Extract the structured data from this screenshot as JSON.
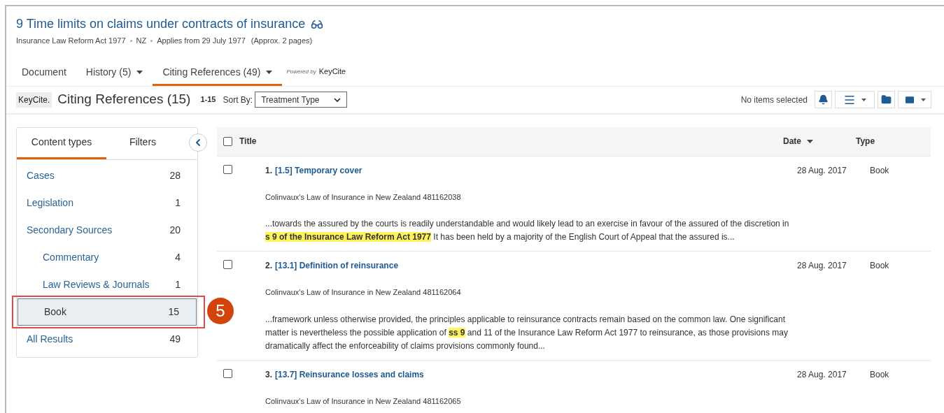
{
  "document": {
    "title": "9 Time limits on claims under contracts of insurance",
    "meta": [
      "Insurance Law Reform Act 1977",
      "NZ",
      "Applies from 29 July 1977"
    ],
    "pages": "(Approx. 2 pages)"
  },
  "tabs": [
    {
      "label": "Document",
      "selected": false,
      "dropdown": false
    },
    {
      "label": "History (5)",
      "selected": false,
      "dropdown": true
    },
    {
      "label": "Citing References (49)",
      "selected": true,
      "dropdown": true
    }
  ],
  "powered_by": {
    "label": "Powered by",
    "brand": "KeyCite"
  },
  "toolbar": {
    "logo": "KeyCite.",
    "heading": "Citing References (15)",
    "range": "1-15",
    "sort_label": "Sort By:",
    "sort_value": "Treatment Type",
    "selection_status": "No items selected"
  },
  "sidebar": {
    "tabs": [
      {
        "label": "Content types",
        "selected": true
      },
      {
        "label": "Filters",
        "selected": false
      }
    ],
    "items": [
      {
        "label": "Cases",
        "count": "28",
        "selected": false
      },
      {
        "label": "Legislation",
        "count": "1",
        "selected": false
      },
      {
        "label": "Secondary Sources",
        "count": "20",
        "selected": false,
        "children": [
          {
            "label": "Commentary",
            "count": "4",
            "selected": false
          },
          {
            "label": "Law Reviews & Journals",
            "count": "1",
            "selected": false
          },
          {
            "label": "Book",
            "count": "15",
            "selected": true
          }
        ]
      },
      {
        "label": "All Results",
        "count": "49",
        "selected": false
      }
    ]
  },
  "callout": {
    "number": "5"
  },
  "table": {
    "select_all_checked": false,
    "columns": [
      "Title",
      "Date",
      "Type"
    ],
    "rows": [
      {
        "number": "1.",
        "title": "[1.5] Temporary cover",
        "date": "28 Aug. 2017",
        "type": "Book",
        "checked": false,
        "source": "Colinvaux's Law of Insurance in New Zealand 481162038",
        "snippet_before": "...towards the assured by the courts is readily understandable and would likely lead to an exercise in favour of the assured of the discretion in ",
        "snippet_highlight": "s 9 of the Insurance Law Reform Act 1977",
        "snippet_after": " It has been held by a majority of the English Court of Appeal that the assured is..."
      },
      {
        "number": "2.",
        "title": "[13.1] Definition of reinsurance",
        "date": "28 Aug. 2017",
        "type": "Book",
        "checked": false,
        "source": "Colinvaux's Law of Insurance in New Zealand 481162064",
        "snippet_before": "...framework unless otherwise provided, the principles applicable to reinsurance contracts remain based on the common law. One significant matter is nevertheless the possible application of ",
        "snippet_highlight": "ss 9",
        "snippet_after": " and 11 of the Insurance Law Reform Act 1977 to reinsurance, as those provisions may dramatically affect the enforceability of claims provisions commonly found..."
      },
      {
        "number": "3.",
        "title": "[13.7] Reinsurance losses and claims",
        "date": "28 Aug. 2017",
        "type": "Book",
        "checked": false,
        "source": "Colinvaux's Law of Insurance in New Zealand 481162065"
      }
    ]
  }
}
